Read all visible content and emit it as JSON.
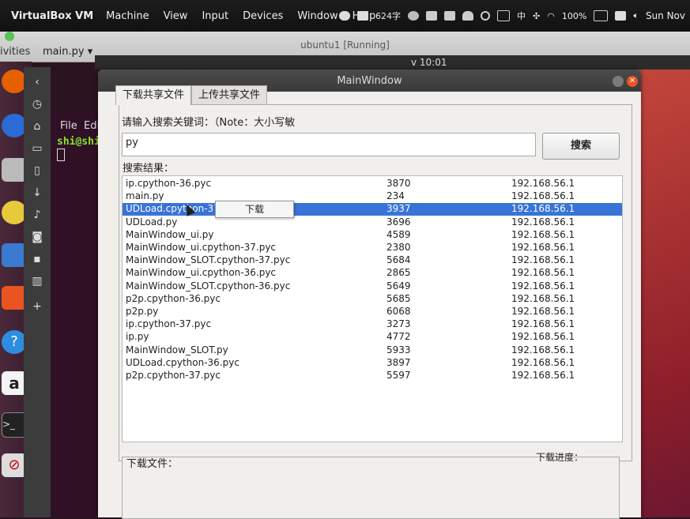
{
  "menubar": {
    "app": "VirtualBox VM",
    "items": [
      "Machine",
      "View",
      "Input",
      "Devices",
      "Window",
      "Help"
    ],
    "status_chars": "624字",
    "battery": "100%",
    "clock": "Sun Nov"
  },
  "vm": {
    "title": "ubuntu1 [Running]",
    "left_tab": "ivities",
    "file_tab": "main.py ▾",
    "clock": "v 10:01"
  },
  "terminal": {
    "menu_file": "File",
    "menu_edit": "Edi",
    "prompt": "shi@shi"
  },
  "window": {
    "title": "MainWindow",
    "tab_download": "下载共享文件",
    "tab_upload": "上传共享文件",
    "keyword_label": "请输入搜索关键词：（Note：大小写敏",
    "search_value": "py",
    "search_button": "搜索",
    "results_label": "搜索结果：",
    "context_menu_item": "下载",
    "download_file_label": "下载文件：",
    "download_progress_label": "下载进度："
  },
  "results": [
    {
      "name": "ip.cpython-36.pyc",
      "size": "3870",
      "ip": "192.168.56.1"
    },
    {
      "name": "main.py",
      "size": "234",
      "ip": "192.168.56.1"
    },
    {
      "name": "UDLoad.cpython-37.",
      "size": "3937",
      "ip": "192.168.56.1",
      "selected": true
    },
    {
      "name": "UDLoad.py",
      "size": "3696",
      "ip": "192.168.56.1"
    },
    {
      "name": "MainWindow_ui.py",
      "size": "4589",
      "ip": "192.168.56.1"
    },
    {
      "name": "MainWindow_ui.cpython-37.pyc",
      "size": "2380",
      "ip": "192.168.56.1"
    },
    {
      "name": "MainWindow_SLOT.cpython-37.pyc",
      "size": "5684",
      "ip": "192.168.56.1"
    },
    {
      "name": "MainWindow_ui.cpython-36.pyc",
      "size": "2865",
      "ip": "192.168.56.1"
    },
    {
      "name": "MainWindow_SLOT.cpython-36.pyc",
      "size": "5649",
      "ip": "192.168.56.1"
    },
    {
      "name": "p2p.cpython-36.pyc",
      "size": "5685",
      "ip": "192.168.56.1"
    },
    {
      "name": "p2p.py",
      "size": "6068",
      "ip": "192.168.56.1"
    },
    {
      "name": "ip.cpython-37.pyc",
      "size": "3273",
      "ip": "192.168.56.1"
    },
    {
      "name": "ip.py",
      "size": "4772",
      "ip": "192.168.56.1"
    },
    {
      "name": "MainWindow_SLOT.py",
      "size": "5933",
      "ip": "192.168.56.1"
    },
    {
      "name": "UDLoad.cpython-36.pyc",
      "size": "3897",
      "ip": "192.168.56.1"
    },
    {
      "name": "p2p.cpython-37.pyc",
      "size": "5597",
      "ip": "192.168.56.1"
    }
  ]
}
